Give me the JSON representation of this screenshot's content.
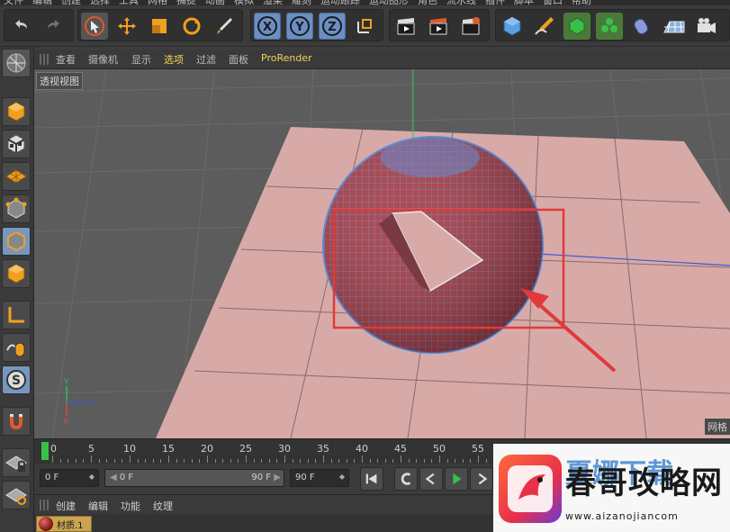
{
  "menu_strip": [
    "文件",
    "编辑",
    "创建",
    "选择",
    "工具",
    "网格",
    "捕捉",
    "动画",
    "模拟",
    "渲染",
    "雕刻",
    "运动跟踪",
    "运动图形",
    "角色",
    "流水线",
    "插件",
    "脚本",
    "窗口",
    "帮助"
  ],
  "viewport_menu": [
    "查看",
    "摄像机",
    "显示",
    "选项",
    "过滤",
    "面板",
    "ProRender"
  ],
  "viewport_menu_highlight": "选项",
  "viewport_label": "透视视图",
  "viewport_grid_label": "网格",
  "axis_labels": {
    "x": "X",
    "y": "Y",
    "z": "Z"
  },
  "timeline": {
    "ticks": [
      "0",
      "5",
      "10",
      "15",
      "20",
      "25",
      "30",
      "35",
      "40",
      "45",
      "50",
      "55"
    ],
    "current_frame": "0 F",
    "range_start": "0 F",
    "range_end": "90 F",
    "end_frame": "90 F"
  },
  "materials_menu": [
    "创建",
    "编辑",
    "功能",
    "纹理"
  ],
  "material_item": "材质.1",
  "watermark": {
    "title": "春哥攻略网",
    "bg_title": "夏娜下载",
    "url": "www.aizanojiancom"
  },
  "colors": {
    "accent_axis_button": "#6b8fc4",
    "playhead": "#36c24a",
    "annotation_red": "#e03a3a",
    "plane_pink": "#d7aaa8",
    "sphere_red": "#a83a42"
  }
}
